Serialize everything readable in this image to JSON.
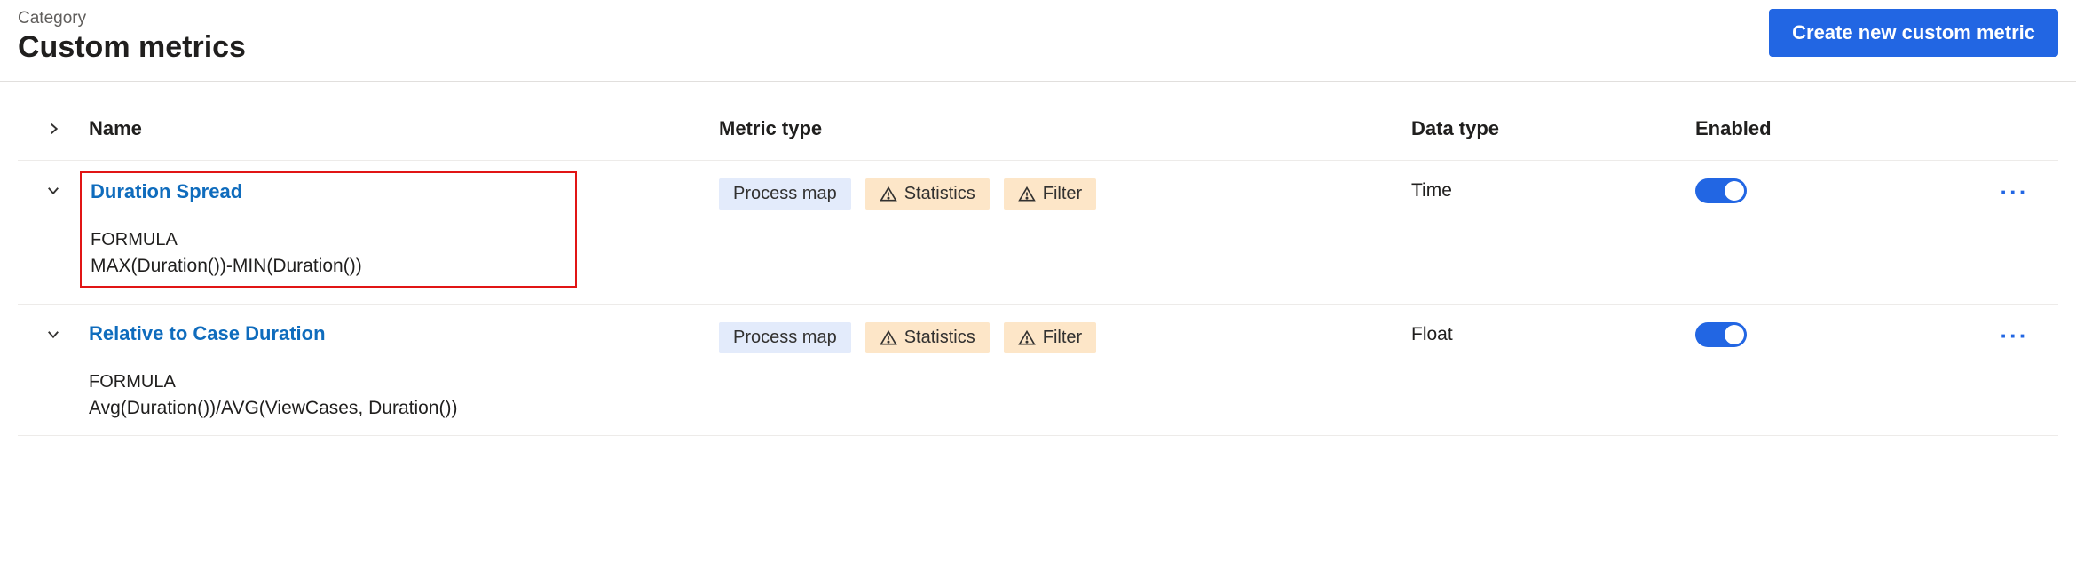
{
  "header": {
    "category_label": "Category",
    "title": "Custom metrics",
    "create_button": "Create new custom metric"
  },
  "columns": {
    "name": "Name",
    "metric_type": "Metric type",
    "data_type": "Data type",
    "enabled": "Enabled"
  },
  "pill_labels": {
    "process_map": "Process map",
    "statistics": "Statistics",
    "filter": "Filter"
  },
  "formula_label": "FORMULA",
  "rows": [
    {
      "name": "Duration Spread",
      "formula": "MAX(Duration())-MIN(Duration())",
      "data_type": "Time",
      "highlighted": true
    },
    {
      "name": "Relative to Case Duration",
      "formula": "Avg(Duration())/AVG(ViewCases, Duration())",
      "data_type": "Float",
      "highlighted": false
    }
  ]
}
